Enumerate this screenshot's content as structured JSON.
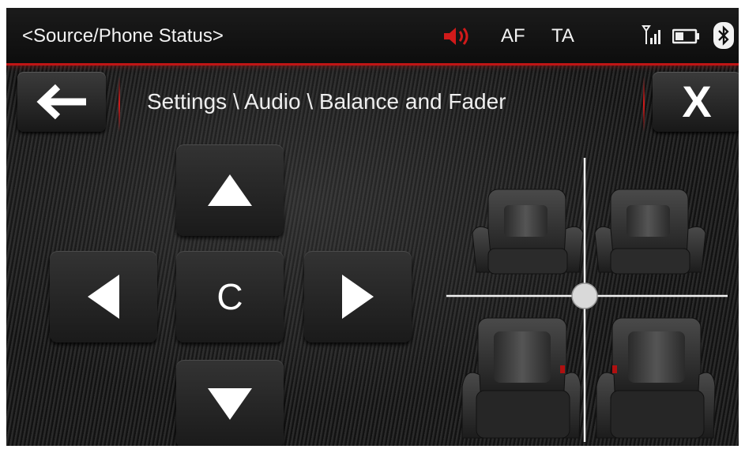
{
  "status_bar": {
    "source_status": "<Source/Phone Status>",
    "af": "AF",
    "ta": "TA",
    "icons": [
      "mute-speaker-icon",
      "signal-icon",
      "battery-icon",
      "bluetooth-icon"
    ],
    "accent_color": "#d01a1a"
  },
  "header": {
    "back_icon": "arrow-left-icon",
    "breadcrumb": "Settings \\ Audio \\ Balance and Fader",
    "close_label": "X"
  },
  "controls": {
    "up_icon": "triangle-up-icon",
    "down_icon": "triangle-down-icon",
    "left_icon": "triangle-left-icon",
    "right_icon": "triangle-right-icon",
    "center_label": "C"
  },
  "seat_map": {
    "balance": 0,
    "fader": 0,
    "seats": [
      "front-left-seat",
      "front-right-seat",
      "rear-left-seat",
      "rear-right-seat"
    ]
  }
}
